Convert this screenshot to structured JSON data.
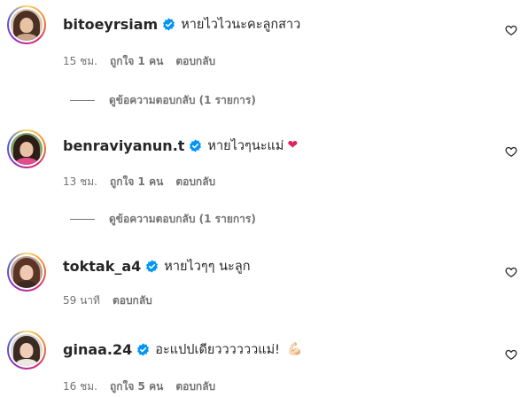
{
  "comments": [
    {
      "username": "bitoeyrsiam",
      "text": "หายไวไวนะคะลูกสาว",
      "emoji": "",
      "time": "15 ชม.",
      "likes": "ถูกใจ 1 คน",
      "reply": "ตอบกลับ",
      "view_replies": "ดูข้อความตอบกลับ (1 รายการ)"
    },
    {
      "username": "benraviyanun.t",
      "text": "หายไวๆนะแม่",
      "emoji": "❤",
      "time": "13 ชม.",
      "likes": "ถูกใจ 1 คน",
      "reply": "ตอบกลับ",
      "view_replies": "ดูข้อความตอบกลับ (1 รายการ)"
    },
    {
      "username": "toktak_a4",
      "text": "หายไวๆๆ นะลูก",
      "emoji": "",
      "time": "59 นาที",
      "likes": "",
      "reply": "ตอบกลับ",
      "view_replies": ""
    },
    {
      "username": "ginaa.24",
      "text": "อะแปปเดียววววววแม่!",
      "emoji": "💪🏻",
      "time": "16 ชม.",
      "likes": "ถูกใจ 5 คน",
      "reply": "ตอบกลับ",
      "view_replies": ""
    }
  ],
  "icons": {
    "verified": "verified-badge-icon",
    "like": "heart-outline-icon"
  },
  "colors": {
    "verified_blue": "#0095f6",
    "text": "#262626",
    "secondary": "#737373",
    "heart_emoji": "#e0245e"
  }
}
